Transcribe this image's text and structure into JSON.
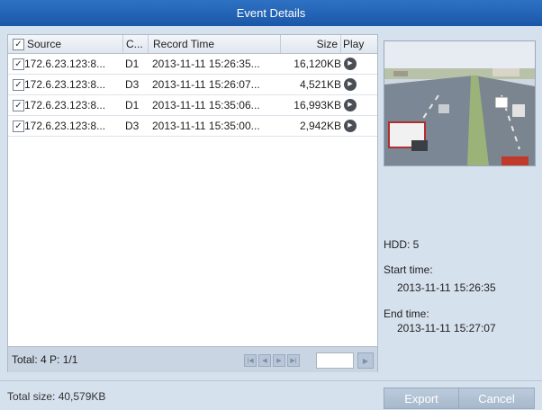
{
  "window": {
    "title": "Event Details"
  },
  "table": {
    "headers": {
      "source": "Source",
      "channel": "C...",
      "record_time": "Record Time",
      "size": "Size",
      "play": "Play"
    },
    "header_checked": true,
    "rows": [
      {
        "checked": true,
        "source": "172.6.23.123:8...",
        "channel": "D1",
        "record_time": "2013-11-11 15:26:35...",
        "size": "16,120KB"
      },
      {
        "checked": true,
        "source": "172.6.23.123:8...",
        "channel": "D3",
        "record_time": "2013-11-11 15:26:07...",
        "size": "4,521KB"
      },
      {
        "checked": true,
        "source": "172.6.23.123:8...",
        "channel": "D1",
        "record_time": "2013-11-11 15:35:06...",
        "size": "16,993KB"
      },
      {
        "checked": true,
        "source": "172.6.23.123:8...",
        "channel": "D3",
        "record_time": "2013-11-11 15:35:00...",
        "size": "2,942KB"
      }
    ]
  },
  "pagination": {
    "summary": "Total: 4  P: 1/1",
    "page_input": ""
  },
  "details": {
    "hdd": "HDD: 5",
    "start_label": "Start time:",
    "start_value": "2013-11-11 15:26:35",
    "end_label": "End time:",
    "end_value": "2013-11-11 15:27:07"
  },
  "footer": {
    "total_size": "Total size: 40,579KB",
    "export_label": "Export",
    "cancel_label": "Cancel"
  },
  "icons": {
    "checkbox": "check-icon",
    "play": "play-icon",
    "first": "first-page-icon",
    "prev": "prev-page-icon",
    "next": "next-page-icon",
    "last": "last-page-icon",
    "go": "go-icon"
  },
  "colors": {
    "title_bar": "#1b57a8",
    "background": "#d6e1ee",
    "button": "#a7b8cc"
  }
}
